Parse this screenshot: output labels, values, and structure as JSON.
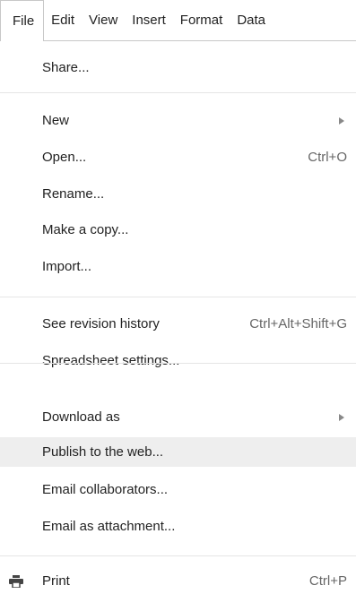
{
  "menubar": {
    "items": [
      {
        "label": "File"
      },
      {
        "label": "Edit"
      },
      {
        "label": "View"
      },
      {
        "label": "Insert"
      },
      {
        "label": "Format"
      },
      {
        "label": "Data"
      }
    ],
    "active_item": "File"
  },
  "file_menu": {
    "groups": [
      {
        "items": [
          {
            "label": "Share..."
          }
        ]
      },
      {
        "items": [
          {
            "label": "New",
            "submenu": true
          },
          {
            "label": "Open...",
            "shortcut": "Ctrl+O"
          },
          {
            "label": "Rename..."
          },
          {
            "label": "Make a copy..."
          },
          {
            "label": "Import..."
          }
        ]
      },
      {
        "items": [
          {
            "label": "See revision history",
            "shortcut": "Ctrl+Alt+Shift+G"
          },
          {
            "label": "Spreadsheet settings..."
          }
        ]
      },
      {
        "items": [
          {
            "label": "Download as",
            "submenu": true
          },
          {
            "label": "Publish to the web...",
            "highlighted": true
          },
          {
            "label": "Email collaborators..."
          },
          {
            "label": "Email as attachment..."
          }
        ]
      },
      {
        "items": [
          {
            "label": "Print",
            "shortcut": "Ctrl+P",
            "icon": "printer-icon"
          }
        ]
      }
    ]
  },
  "colors": {
    "highlight": "#eeeeee",
    "separator": "#e5e5e5",
    "shortcut_text": "#666666",
    "border": "#c8c8c8"
  }
}
